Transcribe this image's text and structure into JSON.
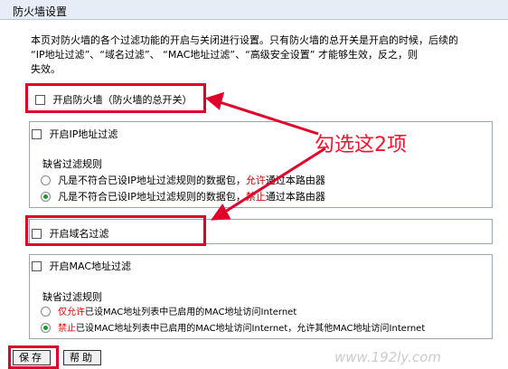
{
  "window": {
    "title": "防火墙设置"
  },
  "description": {
    "line1": "本页对防火墙的各个过滤功能的开启与关闭进行设置。只有防火墙的总开关是开启的时候，后续的",
    "line2": "“IP地址过滤”、“域名过滤”、 “MAC地址过滤”、“高级安全设置” 才能够生效，反之，则",
    "line3": "失效。"
  },
  "firewall_master": {
    "label": "开启防火墙（防火墙的总开关）",
    "checked": false
  },
  "ip_filter": {
    "label": "开启IP地址过滤",
    "checked": false,
    "default_rule_label": "缺省过滤规则",
    "option1_prefix": "凡是不符合已设IP地址过滤规则的数据包，",
    "option1_highlight": "允许",
    "option1_suffix": "通过本路由器",
    "option2_prefix": "凡是不符合已设IP地址过滤规则的数据包，",
    "option2_highlight": "禁止",
    "option2_suffix": "通过本路由器",
    "selected_option": 2
  },
  "domain_filter": {
    "label": "开启域名过滤",
    "checked": false
  },
  "mac_filter": {
    "label": "开启MAC地址过滤",
    "checked": false,
    "default_rule_label": "缺省过滤规则",
    "option1_highlight": "仅允许",
    "option1_suffix": "已设MAC地址列表中已启用的MAC地址访问Internet",
    "option2_highlight": "禁止",
    "option2_suffix": "已设MAC地址列表中已启用的MAC地址访问Internet，允许其他MAC地址访问Internet",
    "selected_option": 2
  },
  "buttons": {
    "save": "保存",
    "help": "帮助"
  },
  "annotation": {
    "text": "勾选这2项"
  },
  "watermark": {
    "text": "www.192ly.com"
  },
  "colors": {
    "highlight": "#e0002a",
    "arrow": "#e0002a",
    "red_text": "#e00000",
    "radio_selected": "#1a9a2a"
  }
}
